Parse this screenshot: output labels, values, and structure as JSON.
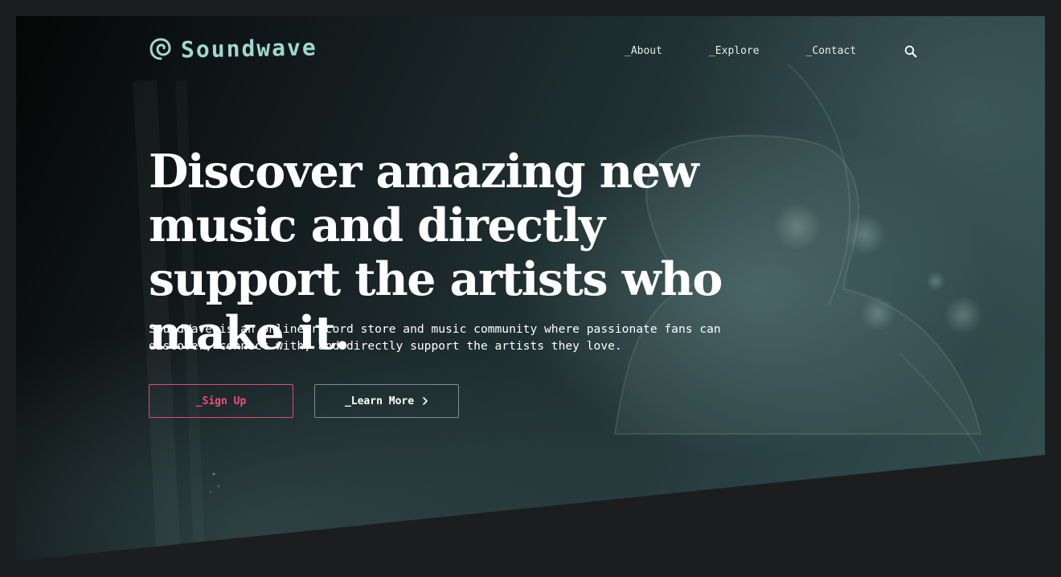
{
  "brand": {
    "name": "Soundwave",
    "logo_icon": "spiral-icon",
    "logo_color": "#9fd8cf"
  },
  "nav": {
    "items": [
      {
        "label": "_About"
      },
      {
        "label": "_Explore"
      },
      {
        "label": "_Contact"
      }
    ],
    "search_icon": "search-icon"
  },
  "hero": {
    "title": "Discover amazing new music and directly support the artists who make it.",
    "description": "SoundWave is an online record store and music community where passionate fans can discover, connect with, and directly support the artists they love.",
    "primary_button": "_Sign Up",
    "secondary_button": "_Learn More",
    "secondary_button_icon": "chevron-right-icon"
  },
  "colors": {
    "page_background": "#1b1d1f",
    "accent": "#ec4f77",
    "text": "#ffffff"
  }
}
